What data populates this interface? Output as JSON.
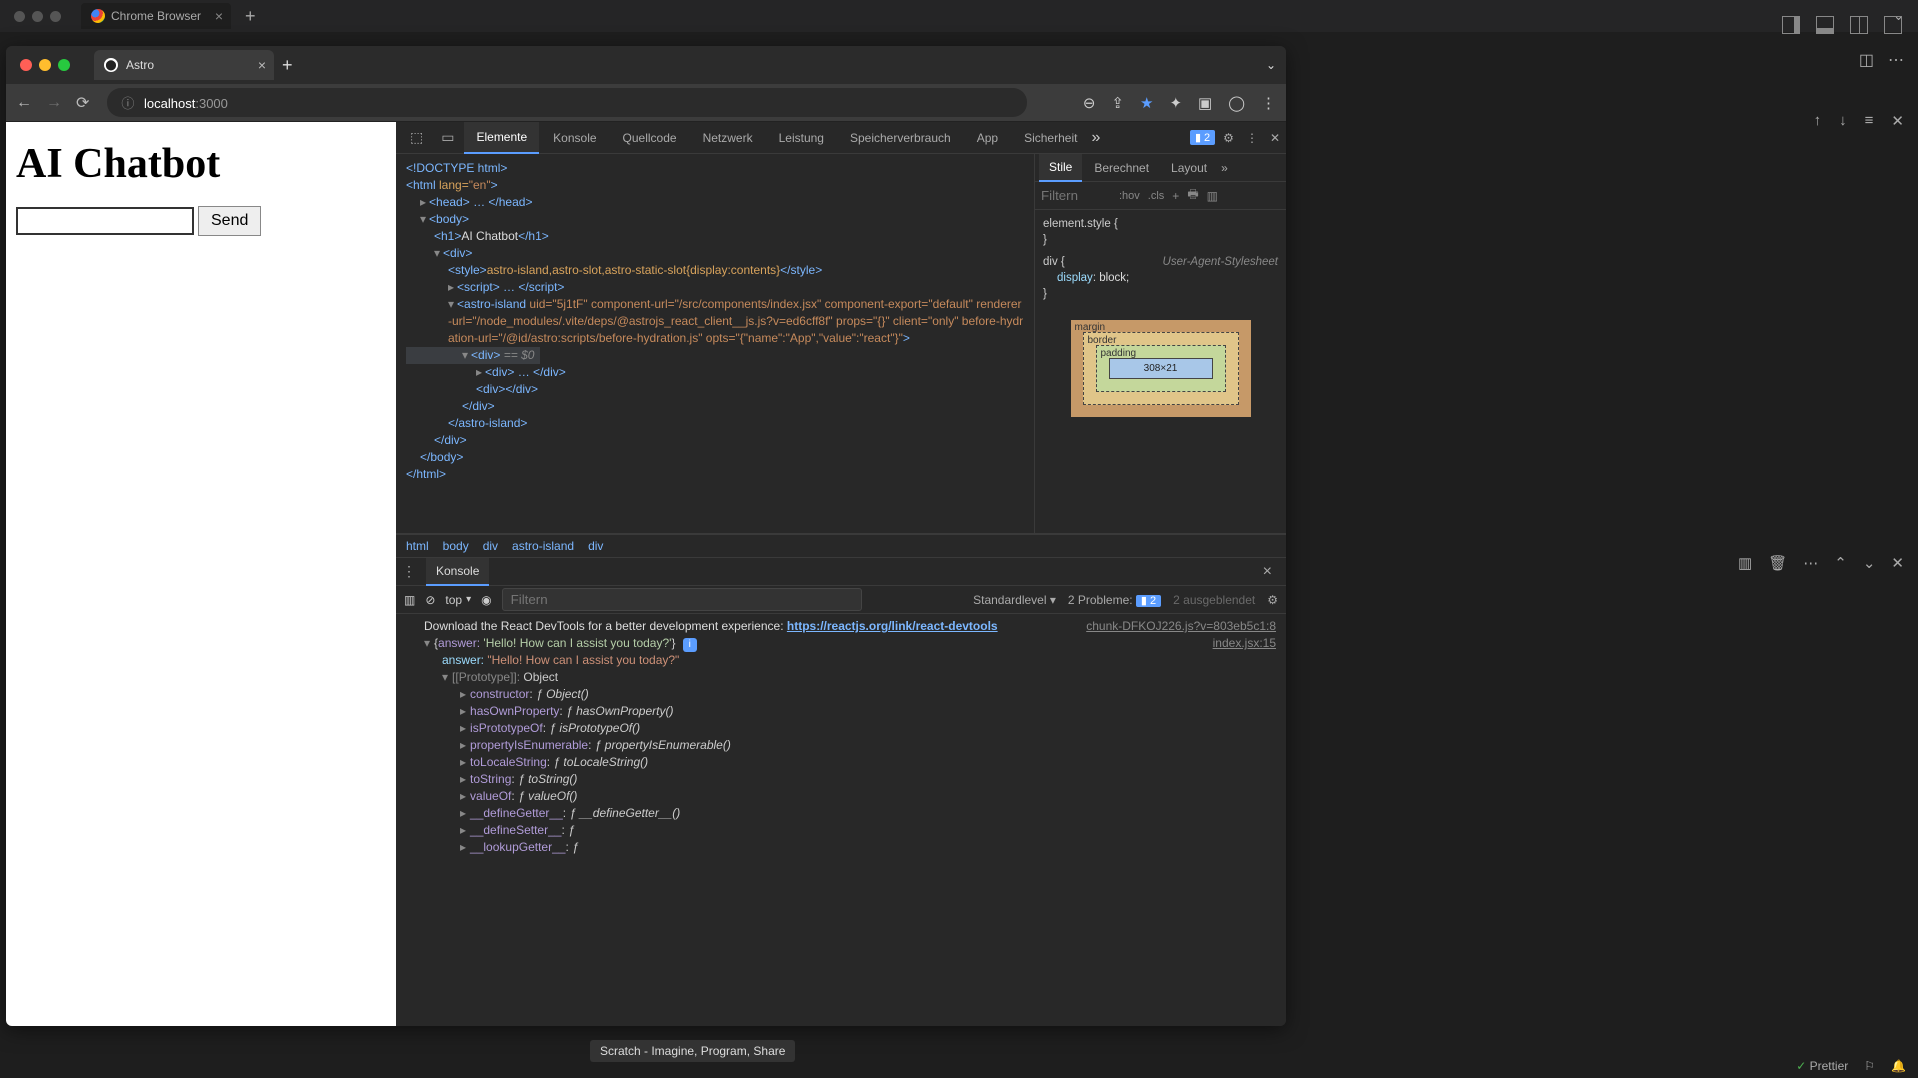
{
  "outer_tab": {
    "label": "Chrome Browser"
  },
  "chrome_tab": {
    "label": "Astro"
  },
  "address": {
    "host": "localhost",
    "port": ":3000"
  },
  "page": {
    "heading": "AI Chatbot",
    "send_label": "Send"
  },
  "devtools": {
    "tabs": [
      "Elemente",
      "Konsole",
      "Quellcode",
      "Netzwerk",
      "Leistung",
      "Speicherverbrauch",
      "App",
      "Sicherheit"
    ],
    "active_tab": "Elemente",
    "issue_count": "2",
    "styles_tabs": [
      "Stile",
      "Berechnet",
      "Layout"
    ],
    "styles_active": "Stile",
    "filter_placeholder": "Filtern",
    "hov": ":hov",
    "cls": ".cls",
    "element_style": "element.style {",
    "brace_close": "}",
    "rule_selector": "div {",
    "rule_prop": "display",
    "rule_val": "block;",
    "ua_label": "User-Agent-Stylesheet",
    "box_model": {
      "margin": "margin",
      "border": "border",
      "padding": "padding",
      "content": "308×21"
    },
    "breadcrumb": [
      "html",
      "body",
      "div",
      "astro-island",
      "div"
    ]
  },
  "dom": {
    "l0": "<!DOCTYPE html>",
    "l1_open": "<html ",
    "l1_attr": "lang=",
    "l1_val": "\"en\"",
    "l1_close": ">",
    "l2": "<head> … </head>",
    "l3": "<body>",
    "l4_a": "<h1>",
    "l4_b": "AI Chatbot",
    "l4_c": "</h1>",
    "l5": "<div>",
    "l6_a": "<style>",
    "l6_b": "astro-island,astro-slot,astro-static-slot{display:contents}",
    "l6_c": "</style>",
    "l7": "<script> … </sc",
    "l7b": "ript>",
    "l8_a": "<astro-island ",
    "l8_b": "uid=\"5j1tF\" component-url=\"/src/components/index.jsx\" component-export=\"default\" renderer-url=\"/node_modules/.vite/deps/@astrojs_react_client__js.js?v=ed6cff8f\" props=\"{}\" client=\"only\" before-hydration-url=\"/@id/astro:scripts/before-hydration.js\" opts=\"{\"name\":\"App\",\"value\":\"react\"}\"",
    "l8_c": ">",
    "l9_a": "<div>",
    "l9_b": " == $0",
    "l10": "<div> … </div>",
    "l11": "<div></div>",
    "l12": "</div>",
    "l13": "</astro-island>",
    "l14": "</div>",
    "l15": "</body>",
    "l16": "</html>"
  },
  "console": {
    "tab": "Konsole",
    "context": "top",
    "filter_placeholder": "Filtern",
    "level": "Standardlevel",
    "problems_label": "2 Probleme:",
    "problems_badge": "2",
    "hidden": "2 ausgeblendet",
    "src1": "chunk-DFKOJ226.js?v=803eb5c1:8",
    "msg1": "Download the React DevTools for a better development experience: ",
    "link1": "https://reactjs.org/link/react-devtools",
    "src2": "index.jsx:15",
    "obj_open": "{",
    "obj_key": "answer:",
    "obj_val": "'Hello! How can I assist you today?'",
    "obj_close": "}",
    "line_answer_key": "answer:",
    "line_answer_val": "\"Hello! How can I assist you today?\"",
    "proto_label": "[[Prototype]]:",
    "proto_val": "Object",
    "methods": [
      {
        "k": "constructor",
        "v": "Object()"
      },
      {
        "k": "hasOwnProperty",
        "v": "hasOwnProperty()"
      },
      {
        "k": "isPrototypeOf",
        "v": "isPrototypeOf()"
      },
      {
        "k": "propertyIsEnumerable",
        "v": "propertyIsEnumerable()"
      },
      {
        "k": "toLocaleString",
        "v": "toLocaleString()"
      },
      {
        "k": "toString",
        "v": "toString()"
      },
      {
        "k": "valueOf",
        "v": "valueOf()"
      },
      {
        "k": "__defineGetter__",
        "v": "__defineGetter__()"
      },
      {
        "k": "__defineSetter__",
        "v": ""
      },
      {
        "k": "__lookupGetter__",
        "v": ""
      }
    ]
  },
  "tooltip": "Scratch - Imagine, Program, Share",
  "status": {
    "prettier": "Prettier"
  }
}
